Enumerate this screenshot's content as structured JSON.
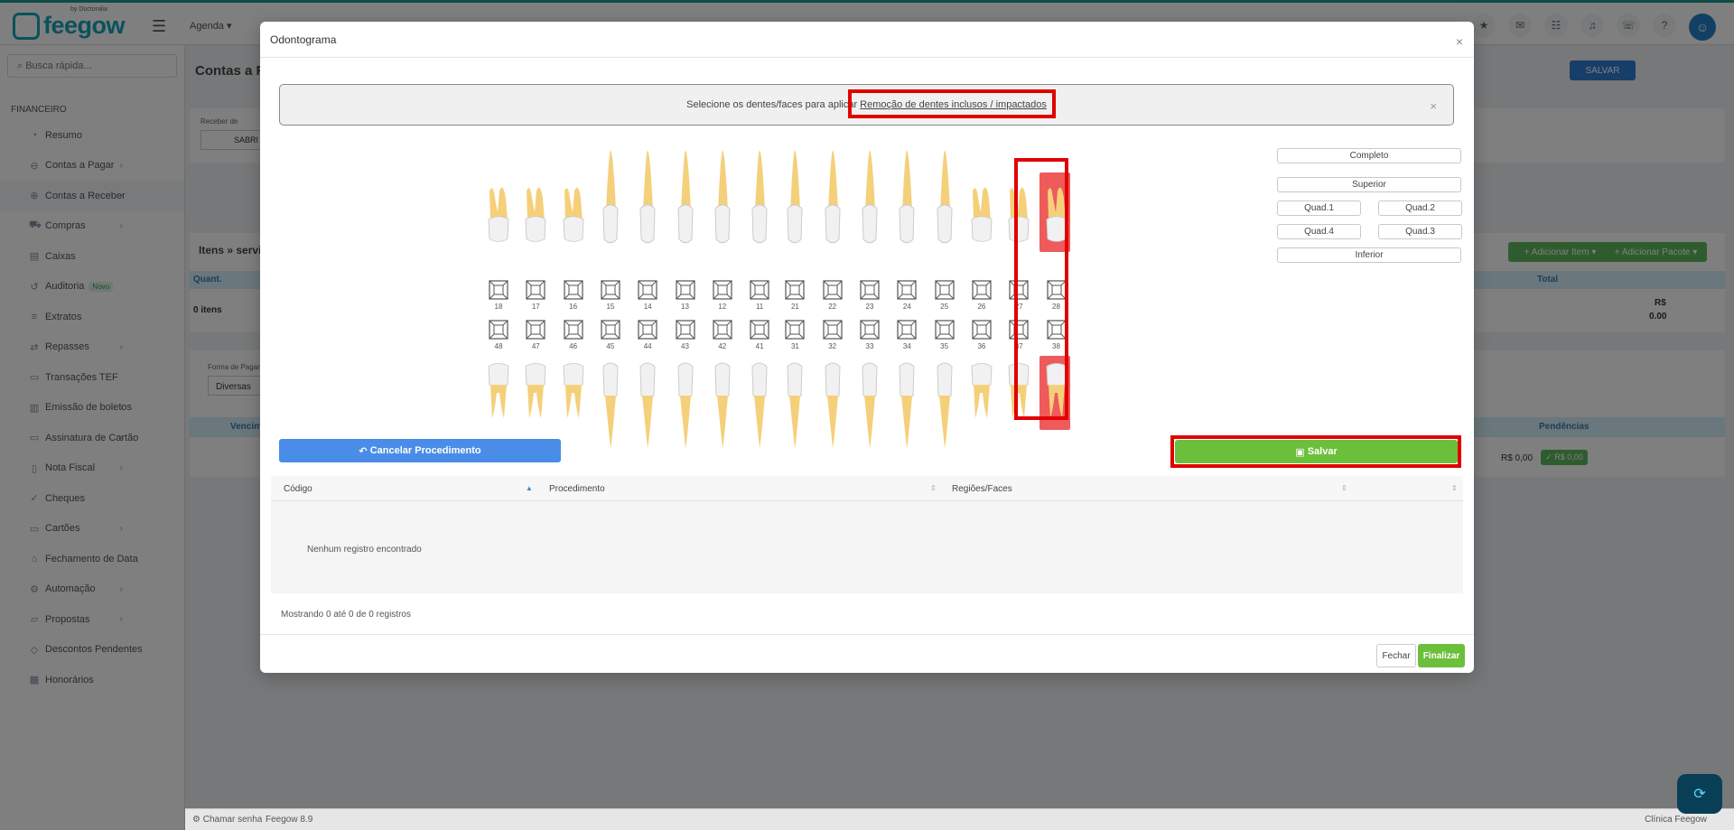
{
  "app": {
    "logo_text": "feegow",
    "logo_sub": "by Doctoralia",
    "nav_first": "Agenda ▾",
    "page_title": "Contas a Re"
  },
  "sidebar": {
    "search_placeholder": "Busca rápida...",
    "section": "FINANCEIRO",
    "items": [
      {
        "label": "Resumo",
        "icon": "chart-icon",
        "chev": false
      },
      {
        "label": "Contas a Pagar",
        "icon": "minus-circle-icon",
        "chev": true
      },
      {
        "label": "Contas a Receber",
        "icon": "plus-circle-icon",
        "chev": true
      },
      {
        "label": "Compras",
        "icon": "cart-icon",
        "chev": true
      },
      {
        "label": "Caixas",
        "icon": "box-icon",
        "chev": false
      },
      {
        "label": "Auditoria",
        "icon": "history-icon",
        "chev": false,
        "badge": "Novo"
      },
      {
        "label": "Extratos",
        "icon": "list-icon",
        "chev": false
      },
      {
        "label": "Repasses",
        "icon": "transfer-icon",
        "chev": true
      },
      {
        "label": "Transações TEF",
        "icon": "card-icon",
        "chev": false
      },
      {
        "label": "Emissão de boletos",
        "icon": "barcode-icon",
        "chev": true
      },
      {
        "label": "Assinatura de Cartão",
        "icon": "card-icon",
        "chev": true
      },
      {
        "label": "Nota Fiscal",
        "icon": "document-icon",
        "chev": true
      },
      {
        "label": "Cheques",
        "icon": "check-icon",
        "chev": false
      },
      {
        "label": "Cartões",
        "icon": "card-icon",
        "chev": true
      },
      {
        "label": "Fechamento de Data",
        "icon": "lock-icon",
        "chev": false
      },
      {
        "label": "Automação",
        "icon": "gear-icon",
        "chev": true
      },
      {
        "label": "Propostas",
        "icon": "folder-icon",
        "chev": true
      },
      {
        "label": "Descontos Pendentes",
        "icon": "tag-icon",
        "chev": false
      },
      {
        "label": "Honorários",
        "icon": "calendar-icon",
        "chev": false
      }
    ]
  },
  "background": {
    "salvar": "SALVAR",
    "adicionar_item": "+ Adicionar Item ▾",
    "adicionar_pacote": "+ Adicionar Pacote ▾",
    "receber_de": "Receber de",
    "receber_value": "SABRI",
    "itens_title": "Itens » serviç",
    "quant": "Quant.",
    "total": "Total",
    "zero_itens": "0 itens",
    "rs": "R$",
    "total_value": "0.00",
    "forma_pagto": "Forma de Pagar",
    "diversas": "Diversas",
    "venc": "Vencim",
    "pendencias": "Pendências",
    "rs000": "R$ 0,00",
    "ok_rs": "✓ R$ 0,00"
  },
  "modal": {
    "title": "Odontograma",
    "alert_prefix": "Selecione os dentes/faces para aplicar",
    "alert_link": "Remoção de dentes inclusos / impactados",
    "quick_select": {
      "completo": "Completo",
      "superior": "Superior",
      "quad1": "Quad.1",
      "quad2": "Quad.2",
      "quad4": "Quad.4",
      "quad3": "Quad.3",
      "inferior": "Inferior"
    },
    "upper_teeth": [
      "18",
      "17",
      "16",
      "15",
      "14",
      "13",
      "12",
      "11",
      "21",
      "22",
      "23",
      "24",
      "25",
      "26",
      "27",
      "28"
    ],
    "lower_teeth": [
      "48",
      "47",
      "46",
      "45",
      "44",
      "43",
      "42",
      "41",
      "31",
      "32",
      "33",
      "34",
      "35",
      "36",
      "37",
      "38"
    ],
    "selected_teeth": [
      "28",
      "38"
    ],
    "cancel_label": "Cancelar Procedimento",
    "save_label": "Salvar",
    "table": {
      "col_codigo": "Código",
      "col_procedimento": "Procedimento",
      "col_regioes": "Regiões/Faces",
      "empty": "Nenhum registro encontrado",
      "info": "Mostrando 0 até 0 de 0 registros"
    },
    "fechar": "Fechar",
    "finalizar": "Finalizar"
  },
  "status": {
    "chamar_senha": "Chamar senha",
    "version": "Feegow 8.9",
    "clinic": "Clínica Feegow"
  },
  "colors": {
    "selected": "#ef5a5a",
    "save_green": "#6cbf3b",
    "cancel_blue": "#4a8de8",
    "highlight_red": "#e00000",
    "tooth_root": "#f5d07a"
  }
}
